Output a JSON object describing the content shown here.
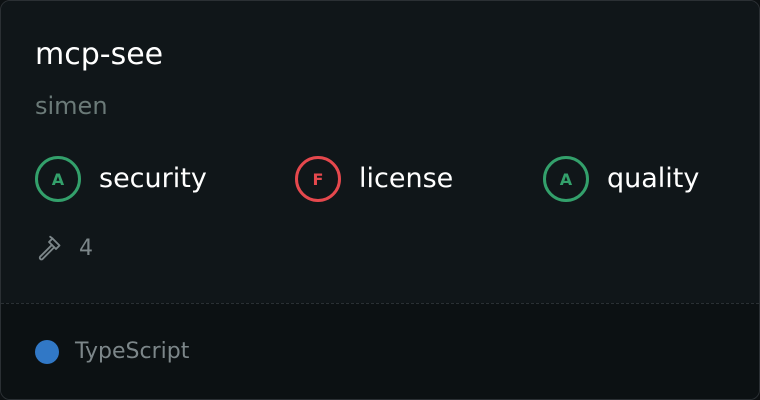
{
  "server": {
    "name": "mcp-see",
    "owner": "simen"
  },
  "grades": [
    {
      "letter": "A",
      "label": "security",
      "status": "pass",
      "color": "#33a06b"
    },
    {
      "letter": "F",
      "label": "license",
      "status": "fail",
      "color": "#e5484d"
    },
    {
      "letter": "A",
      "label": "quality",
      "status": "pass",
      "color": "#33a06b"
    }
  ],
  "tools": {
    "icon": "hammer-icon",
    "count": "4"
  },
  "language": {
    "name": "TypeScript",
    "color": "#3178c6"
  }
}
